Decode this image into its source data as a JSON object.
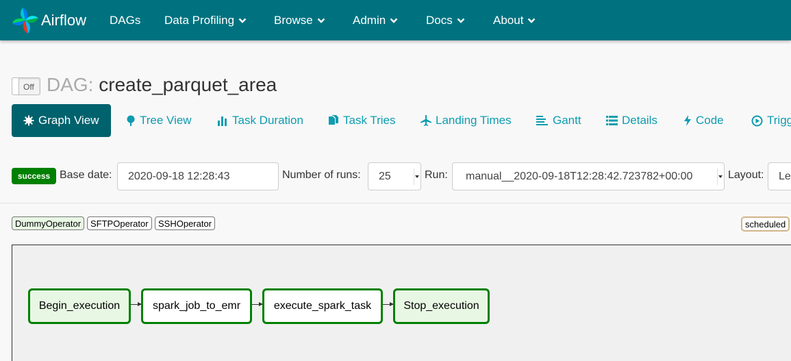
{
  "navbar": {
    "brand": "Airflow",
    "items": [
      {
        "label": "DAGs",
        "has_caret": false
      },
      {
        "label": "Data Profiling",
        "has_caret": true
      },
      {
        "label": "Browse",
        "has_caret": true
      },
      {
        "label": "Admin",
        "has_caret": true
      },
      {
        "label": "Docs",
        "has_caret": true
      },
      {
        "label": "About",
        "has_caret": true
      }
    ],
    "color": "#00727f"
  },
  "dag": {
    "toggle_label": "Off",
    "title_prefix": "DAG:",
    "dag_id": "create_parquet_area"
  },
  "tabs": [
    {
      "label": "Graph View",
      "icon": "gear-icon",
      "active": true
    },
    {
      "label": "Tree View",
      "icon": "tree-icon"
    },
    {
      "label": "Task Duration",
      "icon": "bar-chart-icon"
    },
    {
      "label": "Task Tries",
      "icon": "files-icon"
    },
    {
      "label": "Landing Times",
      "icon": "plane-icon"
    },
    {
      "label": "Gantt",
      "icon": "gantt-icon"
    },
    {
      "label": "Details",
      "icon": "list-icon"
    },
    {
      "label": "Code",
      "icon": "flash-icon"
    },
    {
      "label": "Trigg",
      "icon": "play-icon"
    }
  ],
  "controls": {
    "status_badge": "success",
    "base_date_label": "Base date:",
    "base_date_value": "2020-09-18 12:28:43",
    "num_runs_label": "Number of runs:",
    "num_runs_value": "25",
    "run_label": "Run:",
    "run_value": "manual__2020-09-18T12:28:42.723782+00:00",
    "layout_label": "Layout:",
    "layout_value": "Le"
  },
  "legend": {
    "operators": [
      "DummyOperator",
      "SFTPOperator",
      "SSHOperator"
    ],
    "states": [
      "scheduled"
    ]
  },
  "graph": {
    "nodes": [
      {
        "id": "Begin_execution",
        "operator": "DummyOperator",
        "state": "success"
      },
      {
        "id": "spark_job_to_emr",
        "operator": "SSHOperator",
        "state": "success"
      },
      {
        "id": "execute_spark_task",
        "operator": "SSHOperator",
        "state": "success"
      },
      {
        "id": "Stop_execution",
        "operator": "DummyOperator",
        "state": "success"
      }
    ]
  },
  "colors": {
    "success": "#008000",
    "dummy_operator": "#e8f7e4",
    "tab_active": "#00626d",
    "link": "#0d9cb0",
    "scheduled_border": "#d2b48c"
  }
}
